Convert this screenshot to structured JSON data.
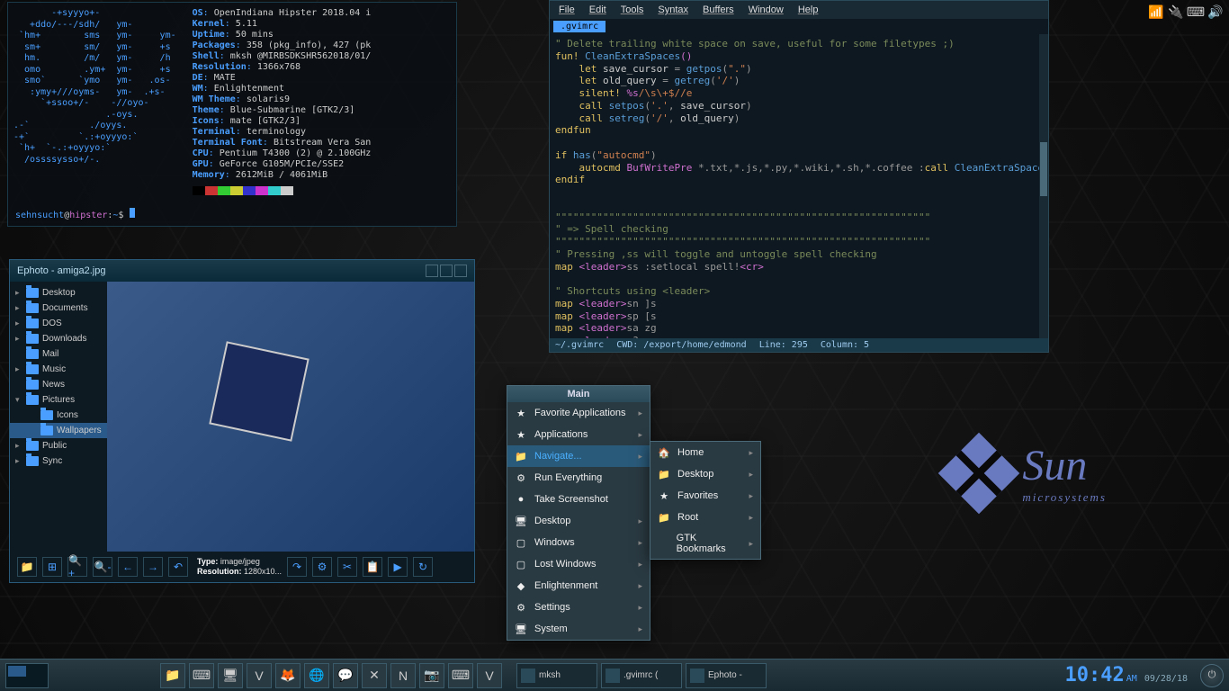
{
  "neofetch": {
    "ascii": "       -+syyyo+-\n   +ddo/---/sdh/   ym-\n `hm+        sms   ym-     ym-\n  sm+        sm/   ym-     +s\n  hm.        /m/   ym-     /h\n  omo        .ym+  ym-     +s\n  smo`      `ymo   ym-   .os-\n   :ymy+///oyms-   ym-  .+s-\n     `+ssoo+/-    -//oyo-\n                 .-oys.\n.-`           ./oyys.\n-+`         `.:+oyyyo:`\n `h+  `-.:+oyyyo:`\n  /ossssysso+/-.",
    "info": [
      {
        "k": "OS",
        "v": "OpenIndiana Hipster 2018.04 i"
      },
      {
        "k": "Kernel",
        "v": "5.11"
      },
      {
        "k": "Uptime",
        "v": "50 mins"
      },
      {
        "k": "Packages",
        "v": "358 (pkg_info), 427 (pk"
      },
      {
        "k": "Shell",
        "v": "mksh @MIRBSDKSHR562018/01/"
      },
      {
        "k": "Resolution",
        "v": "1366x768"
      },
      {
        "k": "DE",
        "v": "MATE"
      },
      {
        "k": "WM",
        "v": "Enlightenment"
      },
      {
        "k": "WM Theme",
        "v": "solaris9"
      },
      {
        "k": "Theme",
        "v": "Blue-Submarine [GTK2/3]"
      },
      {
        "k": "Icons",
        "v": "mate [GTK2/3]"
      },
      {
        "k": "Terminal",
        "v": "terminology"
      },
      {
        "k": "Terminal Font",
        "v": "Bitstream Vera San"
      },
      {
        "k": "CPU",
        "v": "Pentium T4300 (2) @ 2.100GHz"
      },
      {
        "k": "GPU",
        "v": "GeForce G105M/PCIe/SSE2"
      },
      {
        "k": "Memory",
        "v": "2612MiB / 4061MiB"
      }
    ],
    "colors": [
      "#000",
      "#c33",
      "#3c3",
      "#cc3",
      "#33c",
      "#c3c",
      "#3cc",
      "#ccc"
    ],
    "prompt": {
      "user": "sehnsucht",
      "host": "hipster",
      "path": "~",
      "sym": "$"
    }
  },
  "gvim": {
    "menu": [
      "File",
      "Edit",
      "Tools",
      "Syntax",
      "Buffers",
      "Window",
      "Help"
    ],
    "tab": ".gvimrc",
    "status": {
      "file": "~/.gvimrc",
      "cwd": "CWD: /export/home/edmond",
      "line": "Line: 295",
      "col": "Column: 5"
    }
  },
  "systray": [
    "wifi",
    "power-manager",
    "keyboard",
    "volume"
  ],
  "ephoto": {
    "title": "Ephoto - amiga2.jpg",
    "tree": [
      {
        "label": "Desktop",
        "caret": "▸"
      },
      {
        "label": "Documents",
        "caret": "▸"
      },
      {
        "label": "DOS",
        "caret": "▸"
      },
      {
        "label": "Downloads",
        "caret": "▸"
      },
      {
        "label": "Mail",
        "caret": ""
      },
      {
        "label": "Music",
        "caret": "▸"
      },
      {
        "label": "News",
        "caret": ""
      },
      {
        "label": "Pictures",
        "caret": "▾",
        "expanded": true
      },
      {
        "label": "Icons",
        "caret": "",
        "indent": 1
      },
      {
        "label": "Wallpapers",
        "caret": "",
        "indent": 1,
        "sel": true
      },
      {
        "label": "Public",
        "caret": "▸"
      },
      {
        "label": "Sync",
        "caret": "▸"
      }
    ],
    "info": {
      "type_k": "Type:",
      "type_v": "image/jpeg",
      "res_k": "Resolution:",
      "res_v": "1280x10..."
    },
    "toolbar": [
      "📁",
      "⊞",
      "🔍+",
      "🔍-",
      "←",
      "→",
      "↶",
      "↷",
      "⚙",
      "✂",
      "📋",
      "▶",
      "↻"
    ]
  },
  "mainmenu": {
    "title": "Main",
    "items": [
      {
        "label": "Favorite Applications",
        "icon": "★",
        "arrow": true
      },
      {
        "label": "Applications",
        "icon": "★",
        "arrow": true
      },
      {
        "label": "Navigate...",
        "icon": "📁",
        "arrow": true,
        "hl": true
      },
      {
        "label": "Run Everything",
        "icon": "⚙",
        "arrow": false
      },
      {
        "label": "Take Screenshot",
        "icon": "●",
        "arrow": false
      },
      {
        "label": "Desktop",
        "icon": "🖥",
        "arrow": true
      },
      {
        "label": "Windows",
        "icon": "▢",
        "arrow": true
      },
      {
        "label": "Lost Windows",
        "icon": "▢",
        "arrow": true
      },
      {
        "label": "Enlightenment",
        "icon": "◆",
        "arrow": true
      },
      {
        "label": "Settings",
        "icon": "⚙",
        "arrow": true
      },
      {
        "label": "System",
        "icon": "🖥",
        "arrow": true
      }
    ],
    "submenu": [
      {
        "label": "Home",
        "icon": "🏠",
        "arrow": true
      },
      {
        "label": "Desktop",
        "icon": "📁",
        "arrow": true
      },
      {
        "label": "Favorites",
        "icon": "★",
        "arrow": true
      },
      {
        "label": "Root",
        "icon": "📁",
        "arrow": true
      },
      {
        "label": "GTK Bookmarks",
        "icon": "",
        "arrow": true
      }
    ]
  },
  "sunlogo": {
    "big": "Sun",
    "small": "microsystems"
  },
  "taskbar": {
    "launchers": [
      "📁",
      "⌨",
      "🖥",
      "V",
      "🦊",
      "🌐",
      "💬",
      "✕",
      "N",
      "📷",
      "⌨",
      "V"
    ],
    "tasks": [
      {
        "label": "mksh"
      },
      {
        "label": ".gvimrc ("
      },
      {
        "label": "Ephoto -"
      }
    ],
    "clock": {
      "time": "10:42",
      "ampm": "AM",
      "date": "09/28/18"
    }
  }
}
